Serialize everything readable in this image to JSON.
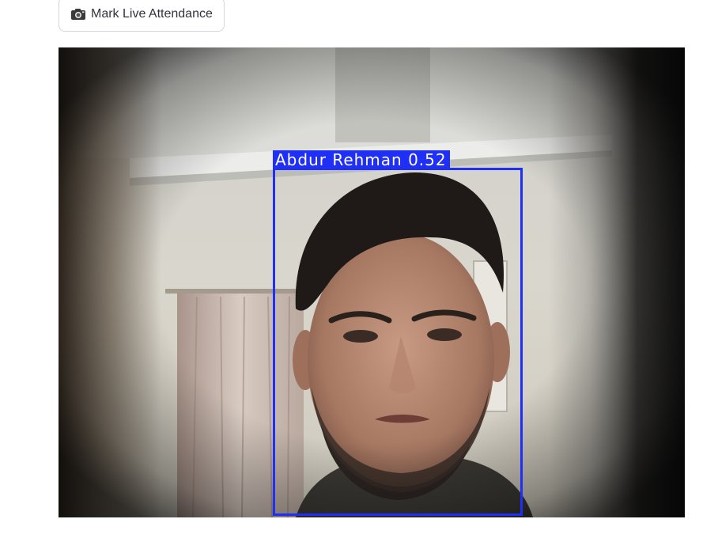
{
  "toolbar": {
    "mark_button_icon": "camera-icon",
    "mark_button_label": "Mark Live Attendance"
  },
  "video": {
    "detection": {
      "label": "Abdur Rehman 0.52",
      "box_color": "#1f2ff5"
    }
  },
  "colors": {
    "button_border": "#d4d6db",
    "button_text": "#31333f",
    "page_background": "#ffffff"
  }
}
